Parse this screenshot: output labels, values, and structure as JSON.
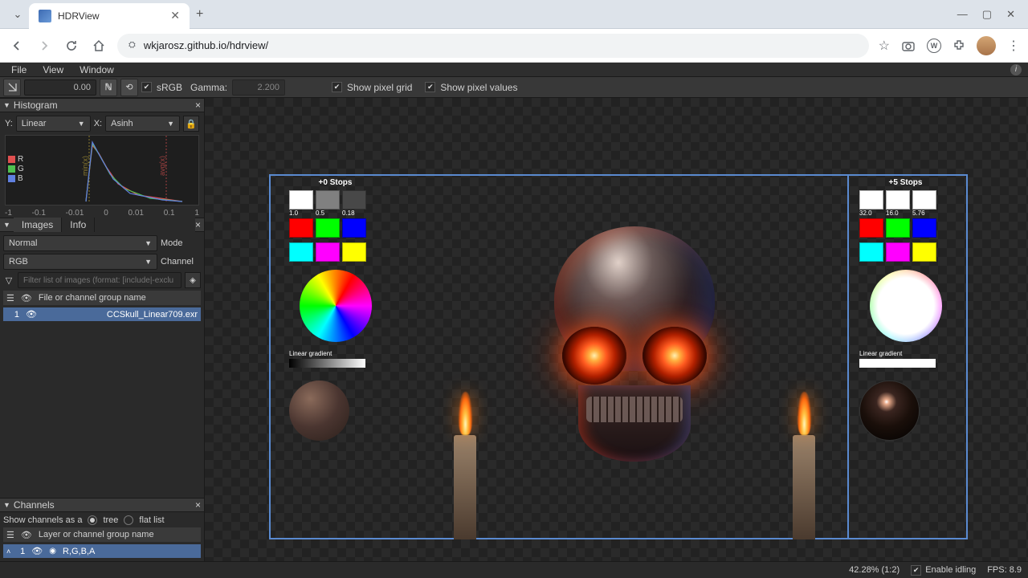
{
  "browser": {
    "tab_title": "HDRView",
    "url": "wkjarosz.github.io/hdrview/"
  },
  "menubar": [
    "File",
    "View",
    "Window"
  ],
  "toolbar": {
    "exposure": "0.00",
    "srgb": "sRGB",
    "gamma_label": "Gamma:",
    "gamma": "2.200",
    "pixel_grid": "Show pixel grid",
    "pixel_values": "Show pixel values"
  },
  "panels": {
    "histogram": {
      "title": "Histogram",
      "y_label": "Y:",
      "y_mode": "Linear",
      "x_label": "X:",
      "x_mode": "Asinh",
      "channels": [
        "R",
        "G",
        "B"
      ],
      "vlabel_min": "min(x)",
      "vlabel_avg": "avg(x)",
      "ticks": [
        "-1",
        "-0.1",
        "-0.01",
        "0",
        "0.01",
        "0.1",
        "1"
      ]
    },
    "images": {
      "tab1": "Images",
      "tab2": "Info",
      "mode_label": "Mode",
      "mode": "Normal",
      "channel_label": "Channel",
      "channel": "RGB",
      "filter_placeholder": "Filter list of images (format: [include|-exclu",
      "header": "File or channel group name",
      "row_index": "1",
      "row_name": "CCSkull_Linear709.exr"
    },
    "channels": {
      "title": "Channels",
      "show_as": "Show channels as a",
      "opt1": "tree",
      "opt2": "flat list",
      "header": "Layer or channel group name",
      "row_index": "1",
      "row_name": "R,G,B,A"
    }
  },
  "viewport": {
    "left_stops": "+0 Stops",
    "right_stops": "+5 Stops",
    "left_vals": [
      "1.0",
      "0.5",
      "0.18"
    ],
    "right_vals": [
      "32.0",
      "16.0",
      "5.76"
    ],
    "grad_label": "Linear gradient"
  },
  "status": {
    "zoom": "42.28% (1:2)",
    "idling": "Enable idling",
    "fps": "FPS: 8.9"
  }
}
